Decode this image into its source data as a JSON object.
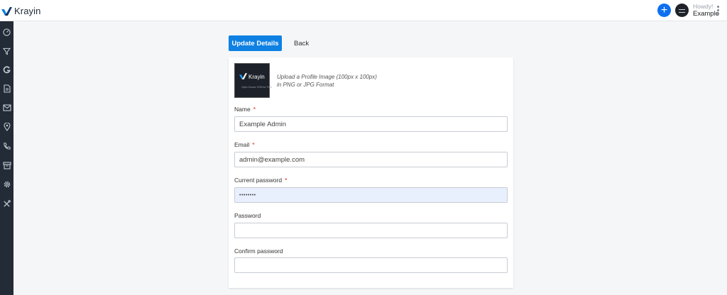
{
  "header": {
    "brand": "Krayin",
    "greeting": "Howdy!",
    "username": "Example",
    "icons": [
      "krayin-logo-icon",
      "add-icon",
      "avatar",
      "more-vertical-icon"
    ]
  },
  "sidebar": {
    "items": [
      {
        "name": "dashboard",
        "icon": "gauge-icon"
      },
      {
        "name": "leads",
        "icon": "filter-icon"
      },
      {
        "name": "quotes",
        "icon": "g-icon"
      },
      {
        "name": "mail",
        "icon": "document-icon"
      },
      {
        "name": "email",
        "icon": "mail-icon"
      },
      {
        "name": "activities",
        "icon": "location-icon"
      },
      {
        "name": "contacts",
        "icon": "phone-icon"
      },
      {
        "name": "products",
        "icon": "archive-icon"
      },
      {
        "name": "settings",
        "icon": "gear-icon"
      },
      {
        "name": "configuration",
        "icon": "tools-icon"
      }
    ]
  },
  "actions": {
    "update_label": "Update Details",
    "back_label": "Back"
  },
  "profile": {
    "image_brand": "Krayin",
    "image_tagline": "Open Source CRM for Free",
    "upload_hint_line1": "Upload a Profile Image (100px x 100px)",
    "upload_hint_line2": "in PNG or JPG Format"
  },
  "form": {
    "name_label": "Name",
    "name_value": "Example Admin",
    "email_label": "Email",
    "email_value": "admin@example.com",
    "current_password_label": "Current password",
    "current_password_value": "••••••••",
    "password_label": "Password",
    "password_value": "",
    "confirm_password_label": "Confirm password",
    "confirm_password_value": "",
    "required_marker": "*"
  },
  "colors": {
    "primary": "#0e81e3",
    "sidebar_bg": "#222b36",
    "required": "#e02020",
    "autofill_bg": "#e8f0fe"
  }
}
